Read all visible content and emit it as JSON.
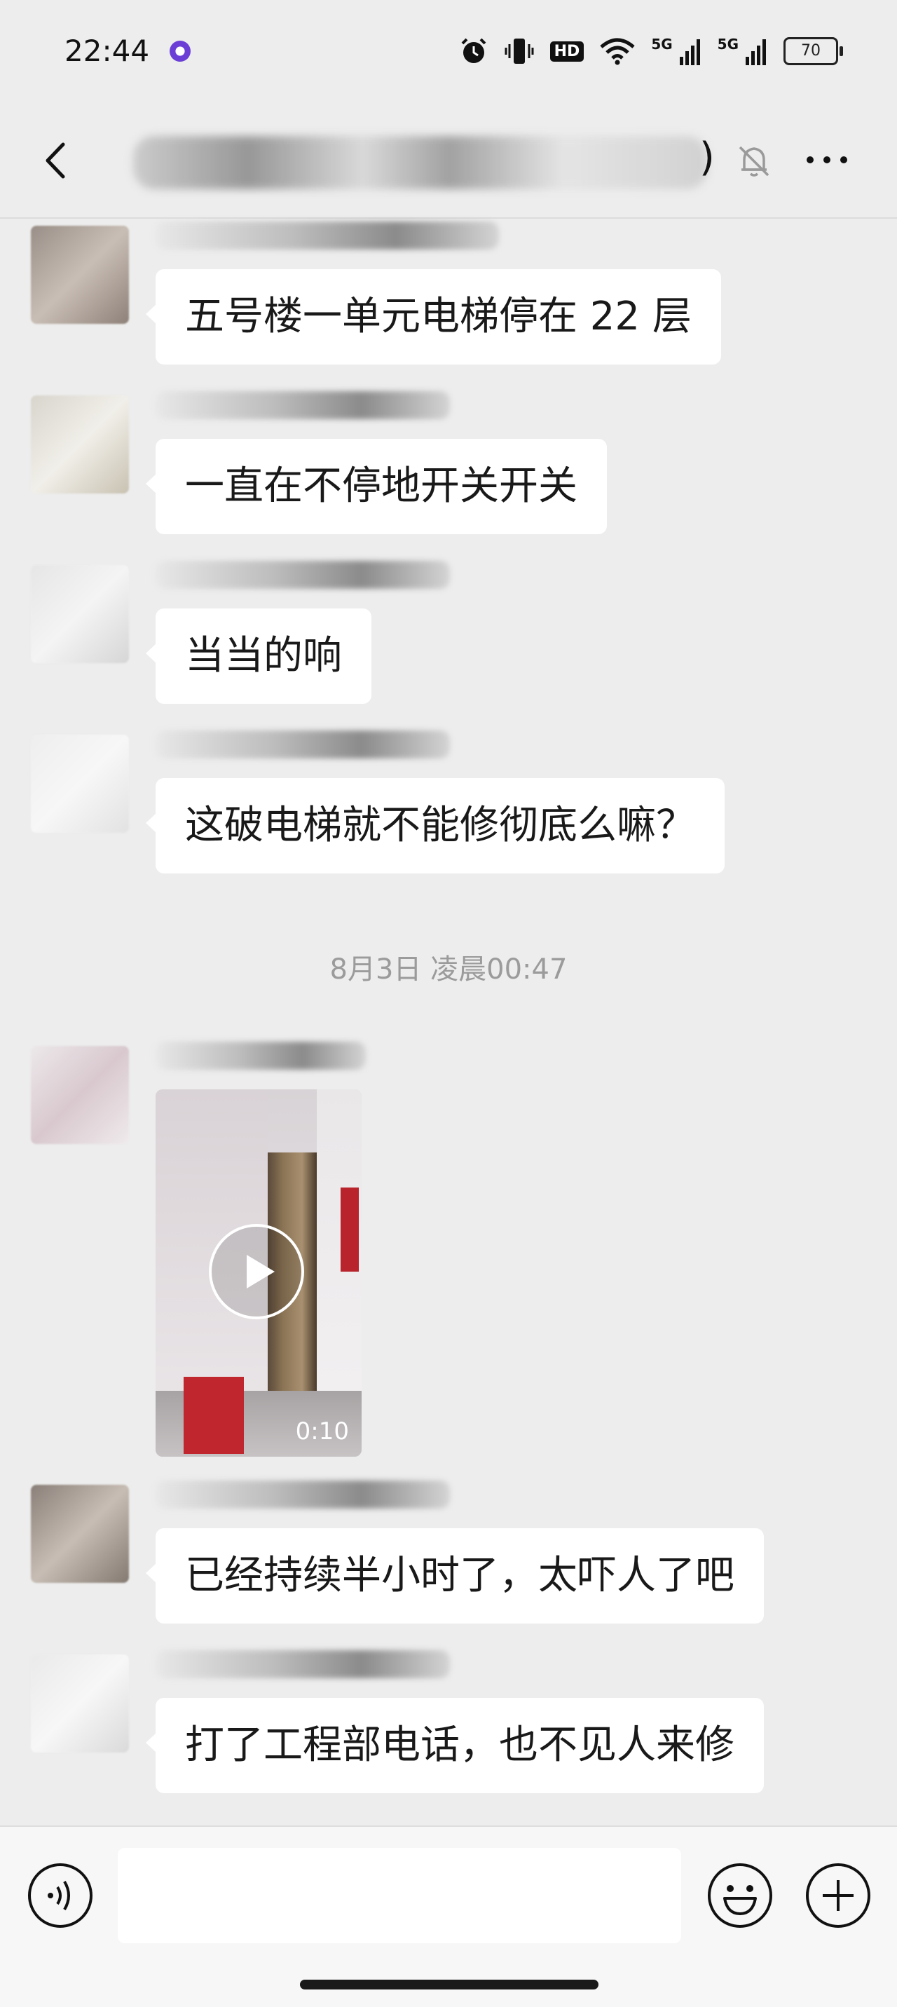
{
  "status_bar": {
    "time": "22:44",
    "net1": "5G",
    "net2": "5G",
    "hd": "HD",
    "battery": "70",
    "icons": [
      "purple-app-icon",
      "alarm-icon",
      "vibrate-icon",
      "hd-icon",
      "wifi-icon",
      "signal-5g-icon",
      "signal-5g-icon",
      "battery-icon"
    ]
  },
  "header": {
    "title_suffix": ")",
    "icons": [
      "back-icon",
      "mute-bell-icon",
      "more-icon"
    ]
  },
  "messages": [
    {
      "text": "五号楼一单元电梯停在 22 层"
    },
    {
      "text": "一直在不停地开关开关"
    },
    {
      "text": "当当的响"
    },
    {
      "text": "这破电梯就不能修彻底么嘛？"
    },
    {
      "video_duration": "0:10"
    },
    {
      "text": "已经持续半小时了，太吓人了吧"
    },
    {
      "text": "打了工程部电话，也不见人来修"
    }
  ],
  "timestamp": "8月3日 凌晨00:47",
  "input_bar": {
    "placeholder": "",
    "icons": [
      "voice-icon",
      "emoji-icon",
      "plus-icon"
    ]
  }
}
